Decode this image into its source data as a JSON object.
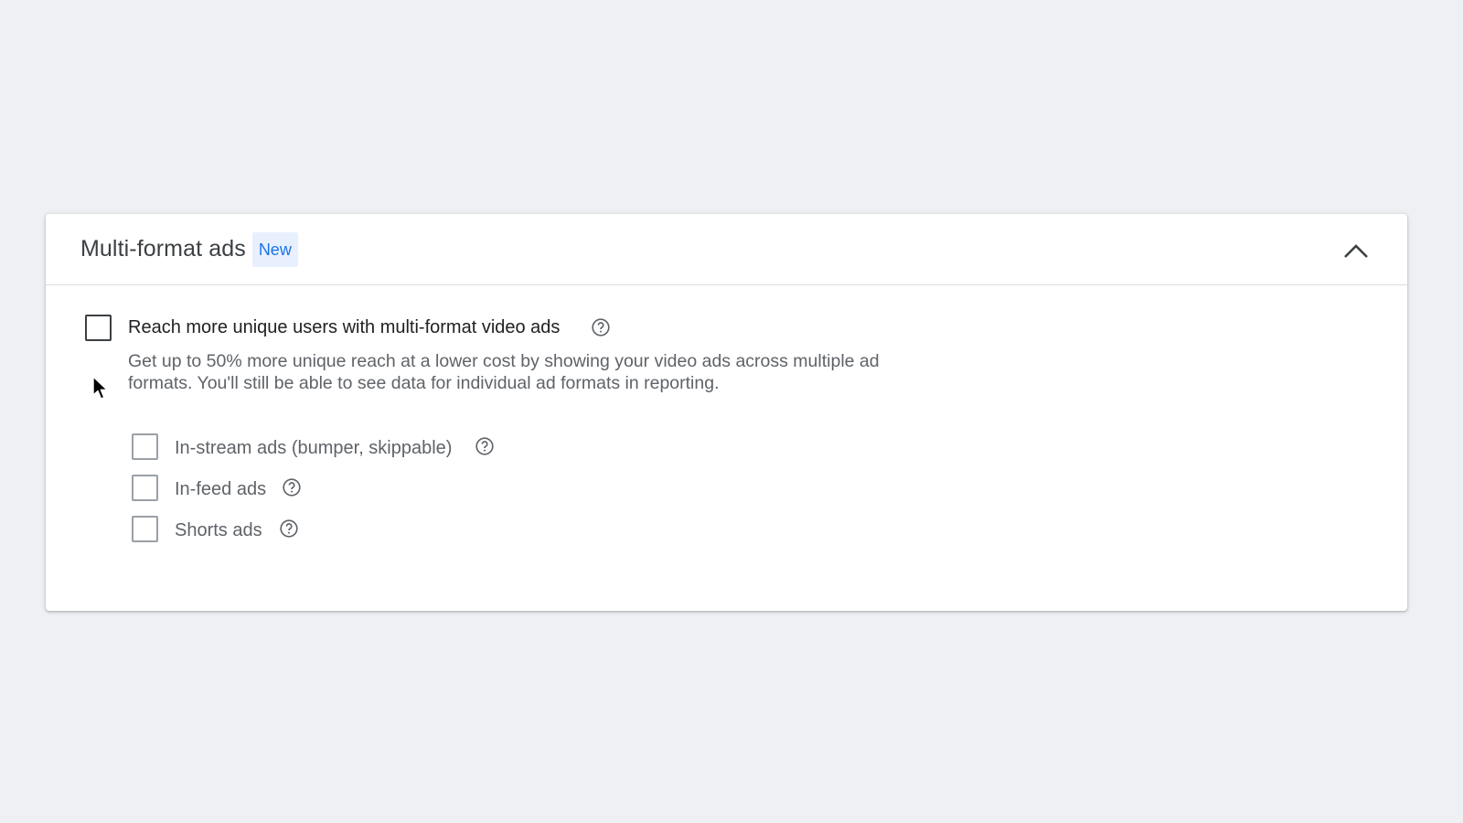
{
  "panel": {
    "title": "Multi-format ads",
    "badge": "New",
    "collapse_icon": "chevron-up-icon"
  },
  "main_option": {
    "label": "Reach more unique users with multi-format video ads",
    "checked": false,
    "description_line1": "Get up to 50% more unique reach at a lower cost by showing your video ads across multiple ad",
    "description_line2": "formats. You'll still be able to see data for individual ad formats in reporting.",
    "help_icon": "help-circle-icon"
  },
  "sub_options": [
    {
      "label": "In-stream ads (bumper, skippable)",
      "checked": false,
      "help_icon": "help-circle-icon"
    },
    {
      "label": "In-feed ads",
      "checked": false,
      "help_icon": "help-circle-icon"
    },
    {
      "label": "Shorts ads",
      "checked": false,
      "help_icon": "help-circle-icon"
    }
  ],
  "colors": {
    "background": "#eff0f4",
    "panel": "#ffffff",
    "badge_bg": "#e8f0fe",
    "badge_text": "#1a73e8"
  }
}
